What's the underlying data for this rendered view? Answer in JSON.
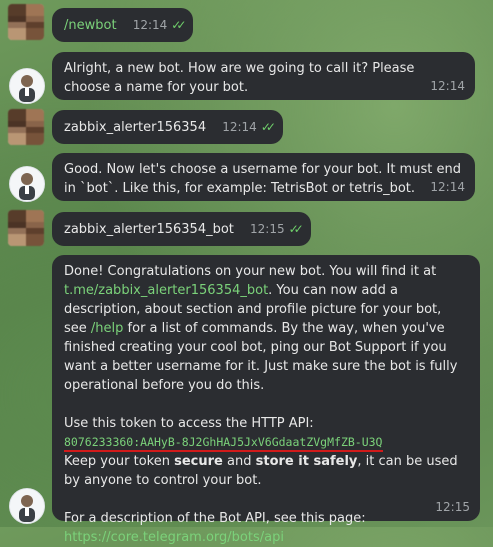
{
  "messages": [
    {
      "from": "user",
      "text": "/newbot",
      "time": "12:14",
      "is_command": true
    },
    {
      "from": "bot",
      "text": "Alright, a new bot. How are we going to call it? Please choose a name for your bot.",
      "time": "12:14"
    },
    {
      "from": "user",
      "text": "zabbix_alerter156354",
      "time": "12:14"
    },
    {
      "from": "bot",
      "text": "Good. Now let's choose a username for your bot. It must end in `bot`. Like this, for example: TetrisBot or tetris_bot.",
      "time": "12:14"
    },
    {
      "from": "user",
      "text": "zabbix_alerter156354_bot",
      "time": "12:15"
    },
    {
      "from": "bot",
      "time": "12:15",
      "intro": "Done! Congratulations on your new bot. You will find it at",
      "bot_link": "t.me/zabbix_alerter156354_bot",
      "after_link": ". You can now add a description, about section and profile picture for your bot, see",
      "help_cmd": "/help",
      "after_help": "for a list of commands. By the way, when you've finished creating your cool bot, ping our Bot Support if you want a better username for it. Just make sure the bot is fully operational before you do this.",
      "token_label": "Use this token to access the HTTP API:",
      "token": "8076233360:AAHyB-8J2GhHAJ5JxV6GdaatZVgMfZB-U3Q",
      "keep_pre": "Keep your token",
      "keep_secure": "secure",
      "keep_and": "and",
      "keep_store": "store it safely",
      "keep_post": ", it can be used by anyone to control your bot.",
      "api_desc": "For a description of the Bot API, see this page:",
      "api_link": "https://core.telegram.org/bots/api"
    }
  ],
  "icons": {
    "read_receipt": "double-check-icon"
  },
  "colors": {
    "bubble": "#2b2d31",
    "accent": "#7bd27a",
    "token_underline": "#d11a1a"
  }
}
